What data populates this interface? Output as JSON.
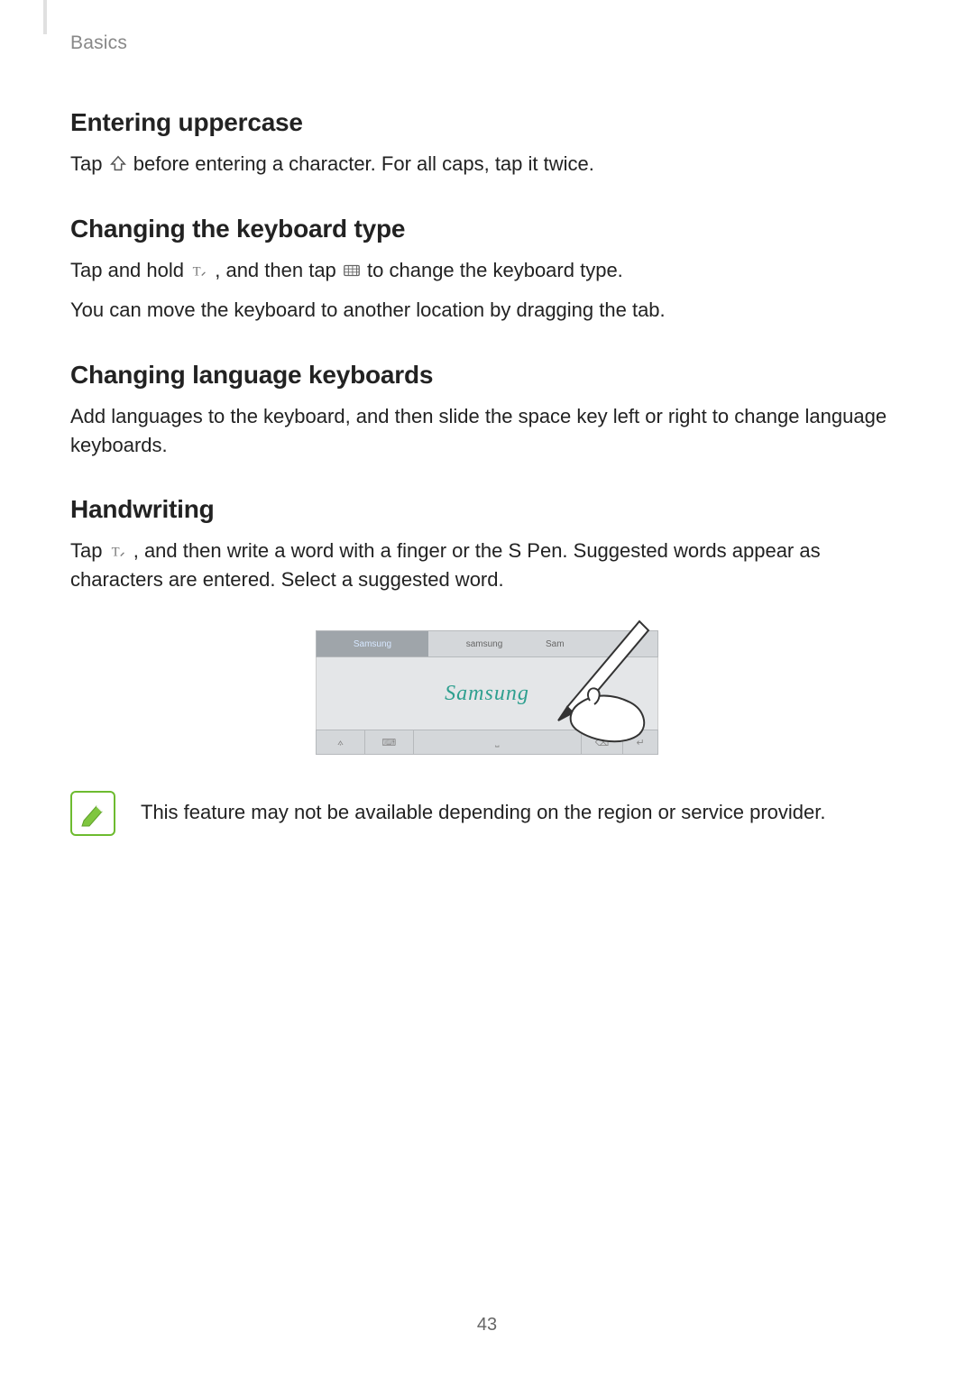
{
  "breadcrumb": "Basics",
  "sections": {
    "uppercase": {
      "heading": "Entering uppercase",
      "text_before": "Tap ",
      "text_after": " before entering a character. For all caps, tap it twice."
    },
    "kbtype": {
      "heading": "Changing the keyboard type",
      "line1_a": "Tap and hold ",
      "line1_b": ", and then tap ",
      "line1_c": " to change the keyboard type.",
      "line2": "You can move the keyboard to another location by dragging the tab."
    },
    "lang": {
      "heading": "Changing language keyboards",
      "text": "Add languages to the keyboard, and then slide the space key left or right to change language keyboards."
    },
    "handwriting": {
      "heading": "Handwriting",
      "text_before": "Tap ",
      "text_after": ", and then write a word with a finger or the S Pen. Suggested words appear as characters are entered. Select a suggested word."
    }
  },
  "figure": {
    "suggestions": {
      "s1": "Samsung",
      "s2": "samsung",
      "s3": "Sam"
    },
    "handwritten": "Samsung",
    "bottom_keys": {
      "k1": "⟑",
      "k2": "⌨",
      "k3": "⎵",
      "k4": "⌫",
      "k5": "↵"
    }
  },
  "note": "This feature may not be available depending on the region or service provider.",
  "page_number": "43"
}
